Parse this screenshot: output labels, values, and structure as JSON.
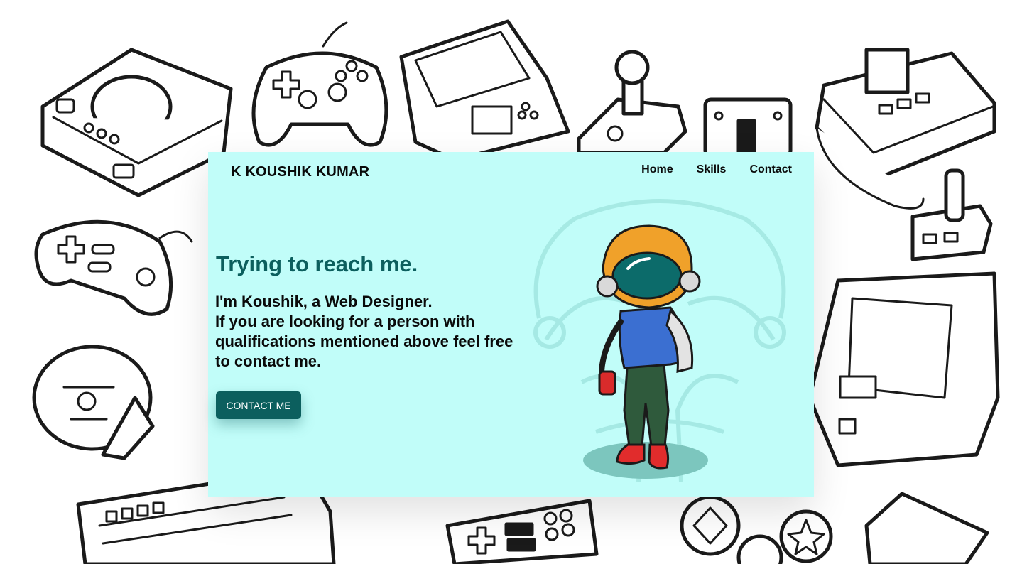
{
  "brand": {
    "name": "K KOUSHIK KUMAR"
  },
  "nav": {
    "items": [
      "Home",
      "Skills",
      "Contact"
    ]
  },
  "hero": {
    "title": "Trying to reach me.",
    "lines": [
      "I'm Koushik, a Web Designer.",
      "If you are looking for a person with qualifications mentioned above feel free to contact me."
    ],
    "cta_label": "CONTACT ME"
  },
  "colors": {
    "card_bg": "#c1fdf9",
    "accent": "#0c5f5e",
    "text": "#0a0a0a"
  },
  "icons": [
    "game-console-icon",
    "gamepad-icon",
    "handheld-console-icon",
    "joystick-icon",
    "keyboard-icon",
    "arcade-cabinet-icon",
    "steering-wheel-icon"
  ]
}
